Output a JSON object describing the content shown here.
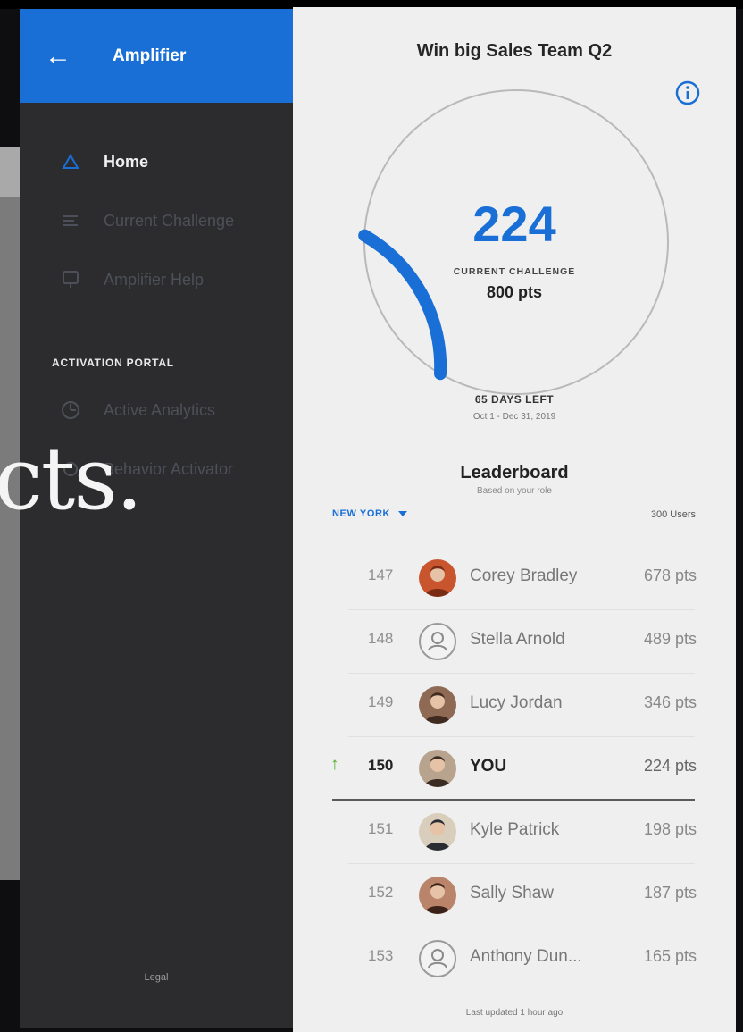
{
  "background": {
    "overlay_text": "cts."
  },
  "sidebar": {
    "header_title": "Amplifier",
    "nav": [
      {
        "label": "Home",
        "icon": "triangle-home-icon"
      },
      {
        "label": "Current Challenge",
        "icon": "list-icon"
      },
      {
        "label": "Amplifier Help",
        "icon": "help-icon"
      }
    ],
    "section_label": "ACTIVATION PORTAL",
    "portal_nav": [
      {
        "label": "Active Analytics",
        "icon": "analytics-icon"
      },
      {
        "label": "Behavior Activator",
        "icon": "activator-icon"
      }
    ],
    "legal": "Legal"
  },
  "main": {
    "title": "Win big Sales Team Q2",
    "score": "224",
    "challenge_label": "CURRENT CHALLENGE",
    "challenge_points": "800 pts",
    "progress_fraction": 0.28,
    "days_left": "65 DAYS LEFT",
    "date_range": "Oct 1 - Dec 31, 2019",
    "leaderboard_title": "Leaderboard",
    "leaderboard_subtitle": "Based on your role",
    "region": "NEW YORK",
    "users_count": "300 Users",
    "rows": [
      {
        "rank": "147",
        "name": "Corey Bradley",
        "pts": "678 pts",
        "avatar": "photo-avatar-1"
      },
      {
        "rank": "148",
        "name": "Stella Arnold",
        "pts": "489 pts",
        "avatar": "placeholder-avatar"
      },
      {
        "rank": "149",
        "name": "Lucy Jordan",
        "pts": "346 pts",
        "avatar": "photo-avatar-2"
      },
      {
        "rank": "150",
        "name": "YOU",
        "pts": "224 pts",
        "avatar": "photo-avatar-3",
        "is_you": true
      },
      {
        "rank": "151",
        "name": "Kyle Patrick",
        "pts": "198 pts",
        "avatar": "photo-avatar-4"
      },
      {
        "rank": "152",
        "name": "Sally Shaw",
        "pts": "187 pts",
        "avatar": "photo-avatar-5"
      },
      {
        "rank": "153",
        "name": "Anthony Dun...",
        "pts": "165 pts",
        "avatar": "placeholder-avatar"
      }
    ],
    "last_updated": "Last updated 1 hour ago"
  },
  "colors": {
    "accent": "#1a6fd6",
    "sidebar_bg": "#2c2c2e",
    "panel_bg": "#efefef",
    "up_arrow": "#4caf2c"
  }
}
